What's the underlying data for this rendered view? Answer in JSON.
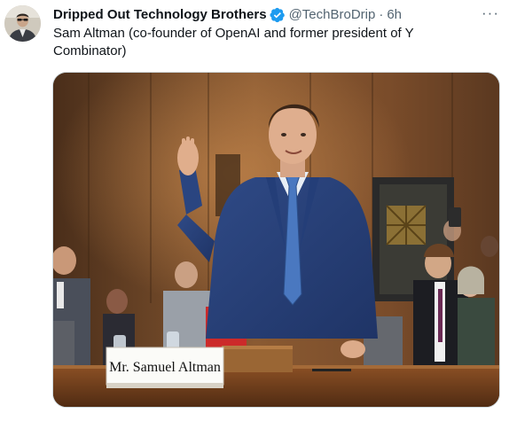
{
  "tweet": {
    "author": {
      "display_name": "Dripped Out Technology Brothers",
      "handle": "@TechBroDrip",
      "verified_icon": "verified-badge-icon",
      "avatar_icon": "avatar"
    },
    "separator": "·",
    "time": "6h",
    "more_label": "···",
    "text": "Sam Altman (co-founder of OpenAI and former president of Y Combinator)",
    "media": {
      "placard_text": "Mr. Samuel Altman"
    }
  },
  "colors": {
    "accent": "#1d9bf0",
    "secondary_text": "#536471",
    "primary_text": "#0f1419"
  }
}
